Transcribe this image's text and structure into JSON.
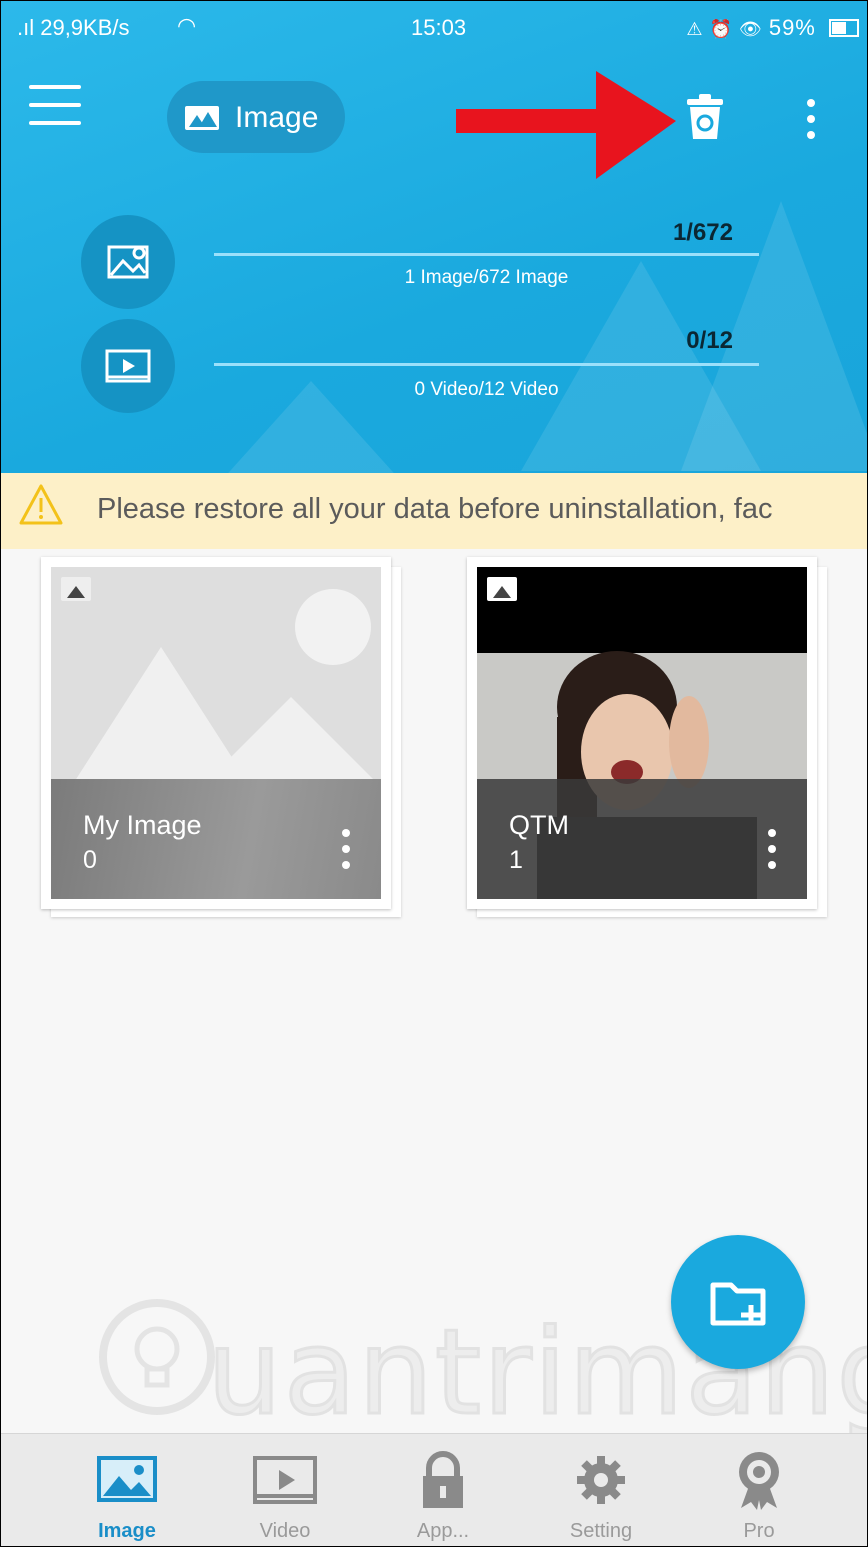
{
  "status_bar": {
    "signal_speed": ".ıl 29,9KB/s",
    "time": "15:03",
    "battery": "59%"
  },
  "toolbar": {
    "menu_icon": "hamburger-menu-icon",
    "category_chip_label": "Image",
    "trash_icon": "recycle-bin-icon",
    "more_icon": "more-vertical-icon",
    "annotation_arrow_color": "#e8141e"
  },
  "stats": [
    {
      "icon": "image-icon",
      "count": "1/672",
      "subtitle": "1 Image/672 Image"
    },
    {
      "icon": "video-icon",
      "count": "0/12",
      "subtitle": "0 Video/12 Video"
    }
  ],
  "warning": {
    "icon": "warning-icon",
    "text": "Please restore all your data before uninstallation, fac"
  },
  "albums": [
    {
      "name": "My Image",
      "count": "0",
      "thumbnail": "placeholder-landscape"
    },
    {
      "name": "QTM",
      "count": "1",
      "thumbnail": "photo-woman"
    }
  ],
  "fab": {
    "icon": "add-folder-icon"
  },
  "watermark": {
    "text": "uantrimang"
  },
  "bottom_nav": [
    {
      "label": "Image",
      "icon": "image-icon",
      "active": true
    },
    {
      "label": "Video",
      "icon": "video-icon",
      "active": false
    },
    {
      "label": "App...",
      "icon": "lock-icon",
      "active": false
    },
    {
      "label": "Setting",
      "icon": "gear-icon",
      "active": false
    },
    {
      "label": "Pro",
      "icon": "award-icon",
      "active": false
    }
  ],
  "colors": {
    "header_blue": "#1aa9de",
    "warning_bg": "#fdf0c8",
    "active_nav": "#1a8ec8"
  }
}
